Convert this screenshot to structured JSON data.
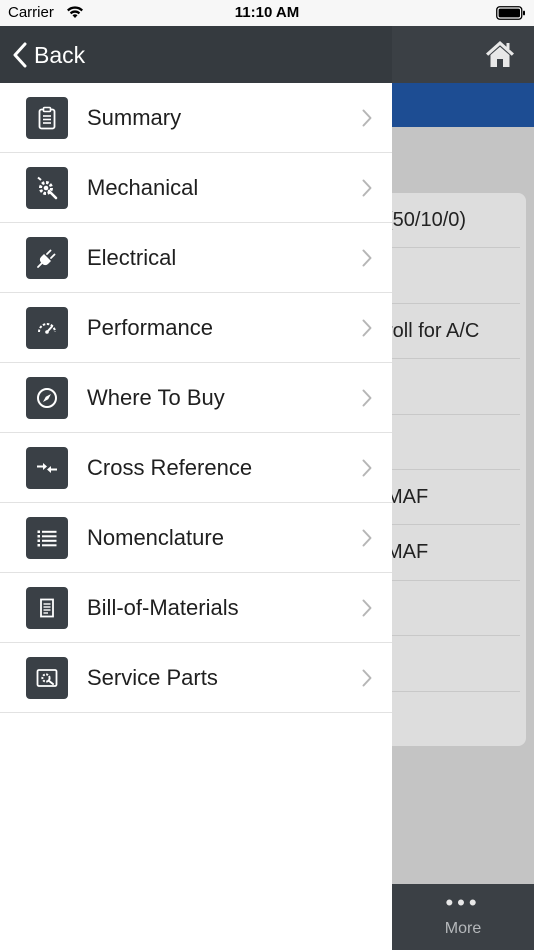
{
  "status_bar": {
    "carrier": "Carrier",
    "time": "11:10 AM"
  },
  "header": {
    "back_label": "Back"
  },
  "menu": {
    "items": [
      {
        "label": "Summary",
        "icon": "clipboard-icon"
      },
      {
        "label": "Mechanical",
        "icon": "gear-wrench-icon"
      },
      {
        "label": "Electrical",
        "icon": "plug-icon"
      },
      {
        "label": "Performance",
        "icon": "gauge-icon"
      },
      {
        "label": "Where To Buy",
        "icon": "compass-icon"
      },
      {
        "label": "Cross Reference",
        "icon": "arrows-exchange-icon"
      },
      {
        "label": "Nomenclature",
        "icon": "list-icon"
      },
      {
        "label": "Bill-of-Materials",
        "icon": "document-icon"
      },
      {
        "label": "Service Parts",
        "icon": "service-parts-icon"
      }
    ]
  },
  "background": {
    "card_rows": [
      "(50/10/0)",
      "",
      "roll for A/C",
      "",
      "",
      "MAF",
      "MAF",
      "",
      "",
      ""
    ],
    "tab_more_label": "More"
  },
  "colors": {
    "drawer_header": "#353a3f",
    "nav_bar": "#3b4045",
    "accent_blue": "#1d4d93"
  }
}
